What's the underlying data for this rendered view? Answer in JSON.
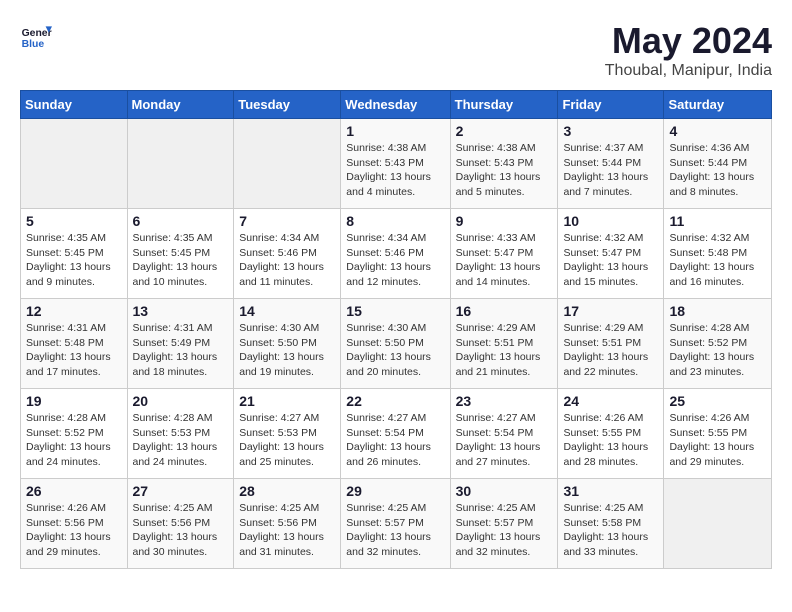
{
  "header": {
    "logo_general": "General",
    "logo_blue": "Blue",
    "month_year": "May 2024",
    "location": "Thoubal, Manipur, India"
  },
  "weekdays": [
    "Sunday",
    "Monday",
    "Tuesday",
    "Wednesday",
    "Thursday",
    "Friday",
    "Saturday"
  ],
  "weeks": [
    [
      {
        "day": "",
        "info": ""
      },
      {
        "day": "",
        "info": ""
      },
      {
        "day": "",
        "info": ""
      },
      {
        "day": "1",
        "info": "Sunrise: 4:38 AM\nSunset: 5:43 PM\nDaylight: 13 hours\nand 4 minutes."
      },
      {
        "day": "2",
        "info": "Sunrise: 4:38 AM\nSunset: 5:43 PM\nDaylight: 13 hours\nand 5 minutes."
      },
      {
        "day": "3",
        "info": "Sunrise: 4:37 AM\nSunset: 5:44 PM\nDaylight: 13 hours\nand 7 minutes."
      },
      {
        "day": "4",
        "info": "Sunrise: 4:36 AM\nSunset: 5:44 PM\nDaylight: 13 hours\nand 8 minutes."
      }
    ],
    [
      {
        "day": "5",
        "info": "Sunrise: 4:35 AM\nSunset: 5:45 PM\nDaylight: 13 hours\nand 9 minutes."
      },
      {
        "day": "6",
        "info": "Sunrise: 4:35 AM\nSunset: 5:45 PM\nDaylight: 13 hours\nand 10 minutes."
      },
      {
        "day": "7",
        "info": "Sunrise: 4:34 AM\nSunset: 5:46 PM\nDaylight: 13 hours\nand 11 minutes."
      },
      {
        "day": "8",
        "info": "Sunrise: 4:34 AM\nSunset: 5:46 PM\nDaylight: 13 hours\nand 12 minutes."
      },
      {
        "day": "9",
        "info": "Sunrise: 4:33 AM\nSunset: 5:47 PM\nDaylight: 13 hours\nand 14 minutes."
      },
      {
        "day": "10",
        "info": "Sunrise: 4:32 AM\nSunset: 5:47 PM\nDaylight: 13 hours\nand 15 minutes."
      },
      {
        "day": "11",
        "info": "Sunrise: 4:32 AM\nSunset: 5:48 PM\nDaylight: 13 hours\nand 16 minutes."
      }
    ],
    [
      {
        "day": "12",
        "info": "Sunrise: 4:31 AM\nSunset: 5:48 PM\nDaylight: 13 hours\nand 17 minutes."
      },
      {
        "day": "13",
        "info": "Sunrise: 4:31 AM\nSunset: 5:49 PM\nDaylight: 13 hours\nand 18 minutes."
      },
      {
        "day": "14",
        "info": "Sunrise: 4:30 AM\nSunset: 5:50 PM\nDaylight: 13 hours\nand 19 minutes."
      },
      {
        "day": "15",
        "info": "Sunrise: 4:30 AM\nSunset: 5:50 PM\nDaylight: 13 hours\nand 20 minutes."
      },
      {
        "day": "16",
        "info": "Sunrise: 4:29 AM\nSunset: 5:51 PM\nDaylight: 13 hours\nand 21 minutes."
      },
      {
        "day": "17",
        "info": "Sunrise: 4:29 AM\nSunset: 5:51 PM\nDaylight: 13 hours\nand 22 minutes."
      },
      {
        "day": "18",
        "info": "Sunrise: 4:28 AM\nSunset: 5:52 PM\nDaylight: 13 hours\nand 23 minutes."
      }
    ],
    [
      {
        "day": "19",
        "info": "Sunrise: 4:28 AM\nSunset: 5:52 PM\nDaylight: 13 hours\nand 24 minutes."
      },
      {
        "day": "20",
        "info": "Sunrise: 4:28 AM\nSunset: 5:53 PM\nDaylight: 13 hours\nand 24 minutes."
      },
      {
        "day": "21",
        "info": "Sunrise: 4:27 AM\nSunset: 5:53 PM\nDaylight: 13 hours\nand 25 minutes."
      },
      {
        "day": "22",
        "info": "Sunrise: 4:27 AM\nSunset: 5:54 PM\nDaylight: 13 hours\nand 26 minutes."
      },
      {
        "day": "23",
        "info": "Sunrise: 4:27 AM\nSunset: 5:54 PM\nDaylight: 13 hours\nand 27 minutes."
      },
      {
        "day": "24",
        "info": "Sunrise: 4:26 AM\nSunset: 5:55 PM\nDaylight: 13 hours\nand 28 minutes."
      },
      {
        "day": "25",
        "info": "Sunrise: 4:26 AM\nSunset: 5:55 PM\nDaylight: 13 hours\nand 29 minutes."
      }
    ],
    [
      {
        "day": "26",
        "info": "Sunrise: 4:26 AM\nSunset: 5:56 PM\nDaylight: 13 hours\nand 29 minutes."
      },
      {
        "day": "27",
        "info": "Sunrise: 4:25 AM\nSunset: 5:56 PM\nDaylight: 13 hours\nand 30 minutes."
      },
      {
        "day": "28",
        "info": "Sunrise: 4:25 AM\nSunset: 5:56 PM\nDaylight: 13 hours\nand 31 minutes."
      },
      {
        "day": "29",
        "info": "Sunrise: 4:25 AM\nSunset: 5:57 PM\nDaylight: 13 hours\nand 32 minutes."
      },
      {
        "day": "30",
        "info": "Sunrise: 4:25 AM\nSunset: 5:57 PM\nDaylight: 13 hours\nand 32 minutes."
      },
      {
        "day": "31",
        "info": "Sunrise: 4:25 AM\nSunset: 5:58 PM\nDaylight: 13 hours\nand 33 minutes."
      },
      {
        "day": "",
        "info": ""
      }
    ]
  ]
}
